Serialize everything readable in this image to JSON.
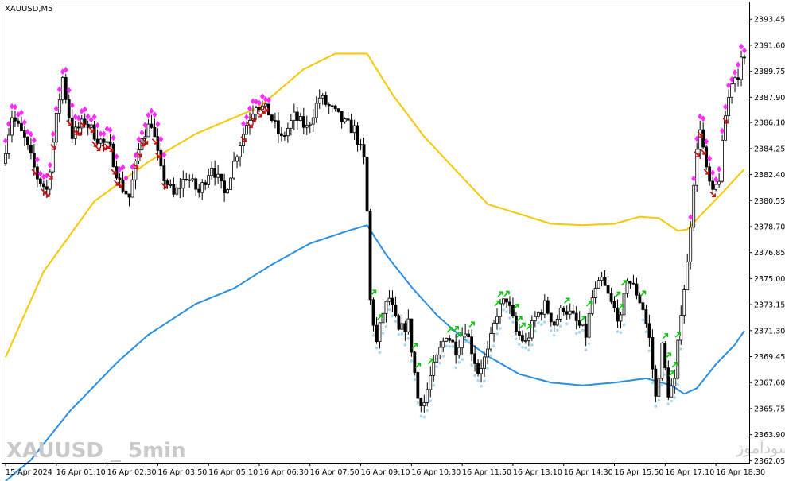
{
  "window": {
    "symbol_label": "XAUUSD,M5"
  },
  "watermarks": {
    "left": "XAUUSD _ 5min",
    "right": "انتشار در سایت سودآموز"
  },
  "colors": {
    "background": "#ffffff",
    "candle": "#000000",
    "upper_band": "#f5c800",
    "lower_band": "#2a8ee0",
    "sell_diamond": "#ff2cff",
    "sell_arrow": "#c81010",
    "buy_arrow": "#10c010",
    "buy_dot": "#a8d8f0"
  },
  "chart_data": {
    "type": "candlestick",
    "symbol": "XAUUSD",
    "timeframe": "M5",
    "y_axis": {
      "ticks": [
        2393.45,
        2391.6,
        2389.75,
        2387.9,
        2386.1,
        2384.25,
        2382.4,
        2380.55,
        2378.7,
        2376.85,
        2375.0,
        2373.15,
        2371.3,
        2369.45,
        2367.6,
        2365.75,
        2363.9,
        2362.05
      ],
      "tick_labels": [
        "2393.45",
        "2391.60",
        "2389.75",
        "2387.90",
        "2386.10",
        "2384.25",
        "2382.40",
        "2380.55",
        "2378.70",
        "2376.85",
        "2375.00",
        "2373.15",
        "2371.30",
        "2369.45",
        "2367.60",
        "2365.75",
        "2363.90",
        "2362.05"
      ],
      "range": [
        2361.9,
        2394.65
      ]
    },
    "x_axis": {
      "tick_labels": [
        "15 Apr 2024",
        "16 Apr 01:10",
        "16 Apr 02:30",
        "16 Apr 03:50",
        "16 Apr 05:10",
        "16 Apr 06:30",
        "16 Apr 07:50",
        "16 Apr 09:10",
        "16 Apr 10:30",
        "16 Apr 11:50",
        "16 Apr 13:10",
        "16 Apr 14:30",
        "16 Apr 15:50",
        "16 Apr 17:10",
        "16 Apr 18:30"
      ],
      "bars_per_label": 16,
      "bar_count": 234
    },
    "anchors": [
      [
        0,
        2383.2
      ],
      [
        3,
        2386.6
      ],
      [
        7,
        2384.9
      ],
      [
        11,
        2382.2
      ],
      [
        14,
        2381.3
      ],
      [
        17,
        2386.4
      ],
      [
        19,
        2389.3
      ],
      [
        22,
        2385.2
      ],
      [
        26,
        2386.2
      ],
      [
        30,
        2385.0
      ],
      [
        34,
        2384.2
      ],
      [
        37,
        2381.8
      ],
      [
        40,
        2380.8
      ],
      [
        44,
        2385.2
      ],
      [
        47,
        2386.1
      ],
      [
        50,
        2382.6
      ],
      [
        54,
        2380.9
      ],
      [
        58,
        2382.3
      ],
      [
        62,
        2381.1
      ],
      [
        66,
        2383.1
      ],
      [
        70,
        2381.0
      ],
      [
        74,
        2384.0
      ],
      [
        77,
        2386.0
      ],
      [
        80,
        2387.5
      ],
      [
        84,
        2386.8
      ],
      [
        88,
        2384.9
      ],
      [
        92,
        2386.5
      ],
      [
        96,
        2385.7
      ],
      [
        100,
        2387.9
      ],
      [
        104,
        2387.0
      ],
      [
        108,
        2386.0
      ],
      [
        111,
        2385.6
      ],
      [
        114,
        2383.4
      ],
      [
        115,
        2379.7
      ],
      [
        116,
        2373.4
      ],
      [
        118,
        2370.4
      ],
      [
        120,
        2372.6
      ],
      [
        122,
        2373.6
      ],
      [
        125,
        2371.2
      ],
      [
        128,
        2371.8
      ],
      [
        131,
        2366.5
      ],
      [
        133,
        2366.2
      ],
      [
        135,
        2368.0
      ],
      [
        137,
        2369.3
      ],
      [
        140,
        2371.1
      ],
      [
        143,
        2370.0
      ],
      [
        146,
        2371.5
      ],
      [
        150,
        2368.4
      ],
      [
        153,
        2369.7
      ],
      [
        156,
        2372.6
      ],
      [
        159,
        2373.6
      ],
      [
        162,
        2371.2
      ],
      [
        165,
        2370.4
      ],
      [
        168,
        2372.2
      ],
      [
        171,
        2373.1
      ],
      [
        174,
        2371.8
      ],
      [
        177,
        2373.0
      ],
      [
        180,
        2372.2
      ],
      [
        184,
        2371.0
      ],
      [
        186,
        2373.6
      ],
      [
        189,
        2374.9
      ],
      [
        192,
        2373.2
      ],
      [
        195,
        2372.0
      ],
      [
        197,
        2375.1
      ],
      [
        200,
        2374.0
      ],
      [
        202,
        2372.9
      ],
      [
        204,
        2370.7
      ],
      [
        206,
        2366.5
      ],
      [
        208,
        2370.1
      ],
      [
        210,
        2366.9
      ],
      [
        212,
        2367.6
      ],
      [
        214,
        2372.8
      ],
      [
        216,
        2376.0
      ],
      [
        218,
        2382.0
      ],
      [
        220,
        2385.9
      ],
      [
        222,
        2382.6
      ],
      [
        224,
        2380.9
      ],
      [
        226,
        2382.2
      ],
      [
        228,
        2386.6
      ],
      [
        230,
        2389.1
      ],
      [
        232,
        2389.6
      ],
      [
        233,
        2390.4
      ]
    ],
    "upper_band": [
      [
        0,
        2369.4
      ],
      [
        12,
        2375.5
      ],
      [
        28,
        2380.5
      ],
      [
        45,
        2383.3
      ],
      [
        60,
        2385.3
      ],
      [
        80,
        2387.2
      ],
      [
        94,
        2389.9
      ],
      [
        104,
        2391.0
      ],
      [
        114,
        2391.0
      ],
      [
        122,
        2388.1
      ],
      [
        132,
        2385.1
      ],
      [
        142,
        2382.7
      ],
      [
        152,
        2380.3
      ],
      [
        162,
        2379.6
      ],
      [
        172,
        2378.9
      ],
      [
        182,
        2378.8
      ],
      [
        192,
        2378.9
      ],
      [
        200,
        2379.4
      ],
      [
        206,
        2379.3
      ],
      [
        212,
        2378.4
      ],
      [
        215,
        2378.5
      ],
      [
        220,
        2379.7
      ],
      [
        226,
        2381.1
      ],
      [
        233,
        2382.8
      ]
    ],
    "lower_band": [
      [
        0,
        2360.6
      ],
      [
        8,
        2362.1
      ],
      [
        20,
        2365.5
      ],
      [
        35,
        2369.0
      ],
      [
        45,
        2371.0
      ],
      [
        60,
        2373.2
      ],
      [
        72,
        2374.3
      ],
      [
        84,
        2376.0
      ],
      [
        96,
        2377.5
      ],
      [
        108,
        2378.4
      ],
      [
        114,
        2378.8
      ],
      [
        120,
        2376.7
      ],
      [
        128,
        2374.4
      ],
      [
        136,
        2372.4
      ],
      [
        144,
        2370.8
      ],
      [
        152,
        2369.5
      ],
      [
        162,
        2368.2
      ],
      [
        172,
        2367.6
      ],
      [
        182,
        2367.4
      ],
      [
        192,
        2367.6
      ],
      [
        202,
        2367.9
      ],
      [
        210,
        2367.4
      ],
      [
        214,
        2366.8
      ],
      [
        218,
        2367.2
      ],
      [
        224,
        2368.9
      ],
      [
        230,
        2370.3
      ],
      [
        233,
        2371.3
      ]
    ]
  }
}
